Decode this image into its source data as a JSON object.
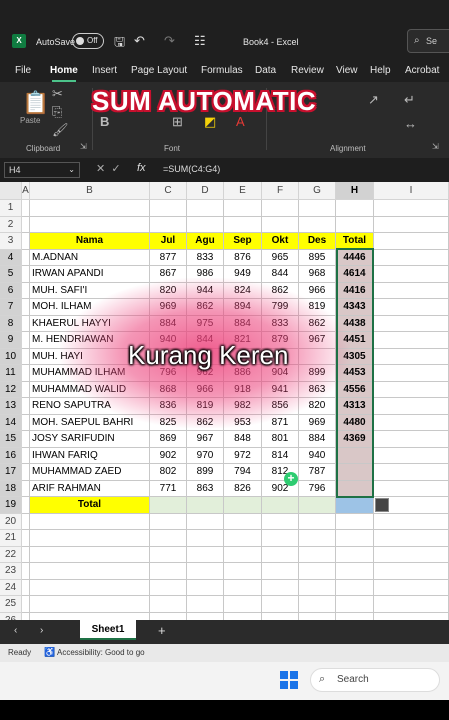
{
  "window": {
    "doc_title": "Book4 - Excel",
    "autosave_label": "AutoSave",
    "autosave_state": "Off",
    "search_placeholder": "Se"
  },
  "menu": [
    "File",
    "Home",
    "Insert",
    "Page Layout",
    "Formulas",
    "Data",
    "Review",
    "View",
    "Help",
    "Acrobat"
  ],
  "ribbon": {
    "groups": [
      "Clipboard",
      "Font",
      "Alignment"
    ],
    "paste_label": "Paste"
  },
  "overlay": {
    "title": "SUM AUTOMATIC",
    "subtitle": "Kurang Keren"
  },
  "formula_bar": {
    "name_box": "H4",
    "fx": "fx",
    "formula": "=SUM(C4:G4)"
  },
  "columns": [
    "A",
    "B",
    "C",
    "D",
    "E",
    "F",
    "G",
    "H",
    "I"
  ],
  "selected_column": "H",
  "rows": [
    "1",
    "2",
    "3",
    "4",
    "5",
    "6",
    "7",
    "8",
    "9",
    "10",
    "11",
    "12",
    "13",
    "14",
    "15",
    "16",
    "17",
    "18",
    "19",
    "20",
    "21",
    "22",
    "23",
    "24",
    "25",
    "26"
  ],
  "table": {
    "headers": [
      "Nama",
      "Jul",
      "Agu",
      "Sep",
      "Okt",
      "Des",
      "Total"
    ],
    "rows": [
      [
        "M.ADNAN",
        "877",
        "833",
        "876",
        "965",
        "895",
        "4446"
      ],
      [
        "IRWAN APANDI",
        "867",
        "986",
        "949",
        "844",
        "968",
        "4614"
      ],
      [
        "MUH. SAFI'I",
        "820",
        "944",
        "824",
        "862",
        "966",
        "4416"
      ],
      [
        "MOH. ILHAM",
        "969",
        "862",
        "894",
        "799",
        "819",
        "4343"
      ],
      [
        "KHAERUL HAYYI",
        "884",
        "975",
        "884",
        "833",
        "862",
        "4438"
      ],
      [
        "M. HENDRIAWAN",
        "940",
        "844",
        "821",
        "879",
        "967",
        "4451"
      ],
      [
        "MUH. HAYI",
        "",
        "",
        "",
        "",
        "",
        "4305"
      ],
      [
        "MUHAMMAD ILHAM",
        "796",
        "962",
        "886",
        "904",
        "899",
        "4453"
      ],
      [
        "MUHAMMAD WALID",
        "868",
        "966",
        "918",
        "941",
        "863",
        "4556"
      ],
      [
        "RENO SAPUTRA",
        "836",
        "819",
        "982",
        "856",
        "820",
        "4313"
      ],
      [
        "MOH. SAEPUL BAHRI",
        "825",
        "862",
        "953",
        "871",
        "969",
        "4480"
      ],
      [
        "JOSY SARIFUDIN",
        "869",
        "967",
        "848",
        "801",
        "884",
        "4369"
      ],
      [
        "IHWAN FARIQ",
        "902",
        "970",
        "972",
        "814",
        "940",
        ""
      ],
      [
        "MUHAMMAD ZAED",
        "802",
        "899",
        "794",
        "812",
        "787",
        ""
      ],
      [
        "ARIF RAHMAN",
        "771",
        "863",
        "826",
        "902",
        "796",
        ""
      ]
    ],
    "total_label": "Total"
  },
  "sheet_tab": "Sheet1",
  "status": {
    "ready": "Ready",
    "accessibility": "Accessibility: Good to go"
  },
  "taskbar": {
    "search": "Search"
  }
}
